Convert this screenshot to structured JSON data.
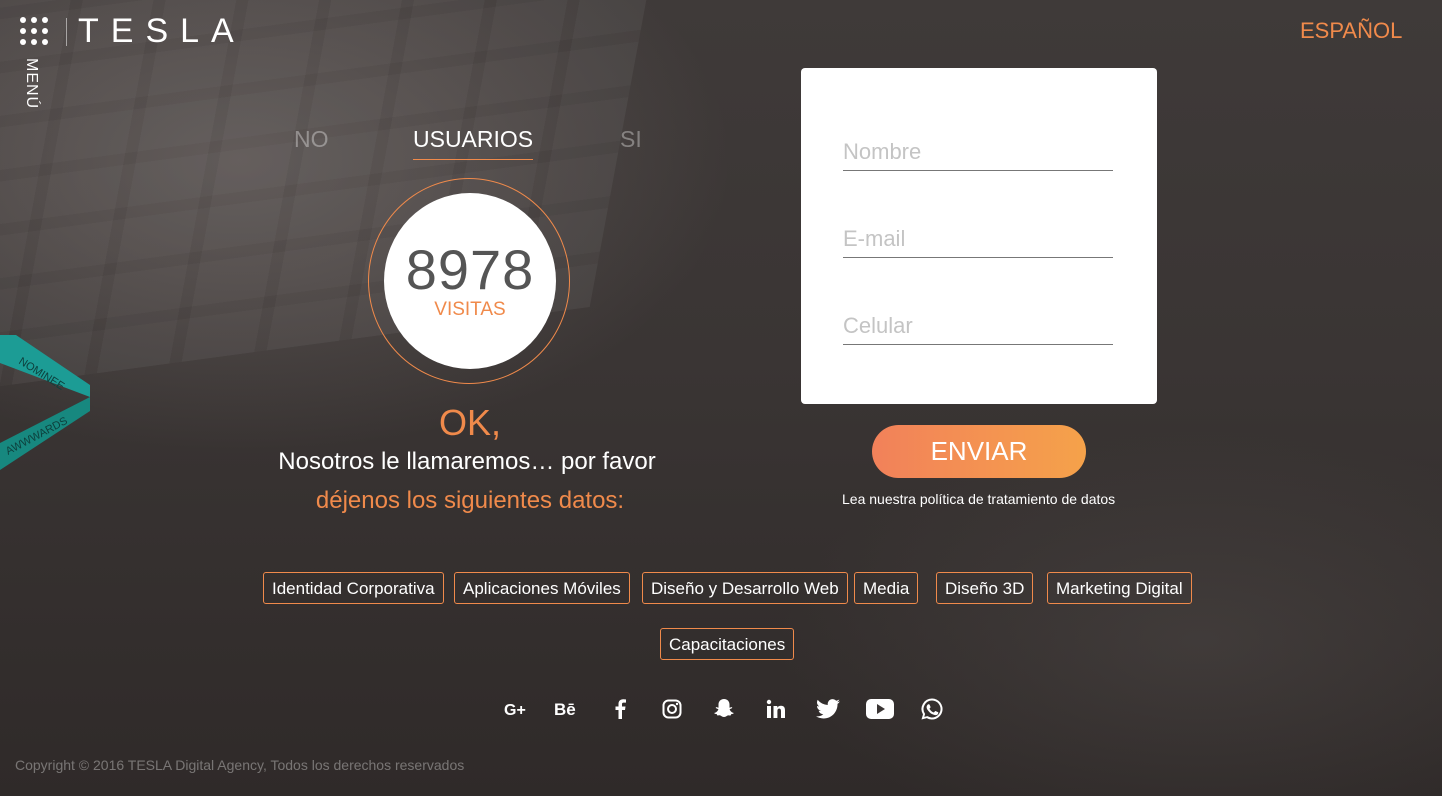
{
  "header": {
    "logo_text": "TESLA",
    "menu_label": "MENÚ",
    "language": "ESPAÑOL",
    "accent_color": "#f08a4b"
  },
  "tabs": [
    {
      "label": "NO"
    },
    {
      "label": "USUARIOS",
      "active": true
    },
    {
      "label": "SI"
    }
  ],
  "counter": {
    "value": "8978",
    "label": "VISITAS"
  },
  "message": {
    "ok": "OK,",
    "line1": "Nosotros le llamaremos… por favor",
    "line2": "déjenos los siguientes datos:"
  },
  "form": {
    "name_placeholder": "Nombre",
    "email_placeholder": "E-mail",
    "phone_placeholder": "Celular",
    "submit_label": "ENVIAR",
    "policy_text": "Lea nuestra política de tratamiento de datos"
  },
  "services": [
    "Identidad Corporativa",
    "Aplicaciones Móviles",
    "Diseño y Desarrollo Web",
    "Media",
    "Diseño 3D",
    "Marketing Digital",
    "Capacitaciones"
  ],
  "social_icons": [
    "google-plus-icon",
    "behance-icon",
    "facebook-icon",
    "instagram-icon",
    "snapchat-icon",
    "linkedin-icon",
    "twitter-icon",
    "youtube-icon",
    "whatsapp-icon"
  ],
  "badge": {
    "line1": "NOMINEE",
    "line2": "AWWWARDS"
  },
  "footer": {
    "copyright": "Copyright © 2016 TESLA Digital Agency, Todos los derechos reservados"
  }
}
